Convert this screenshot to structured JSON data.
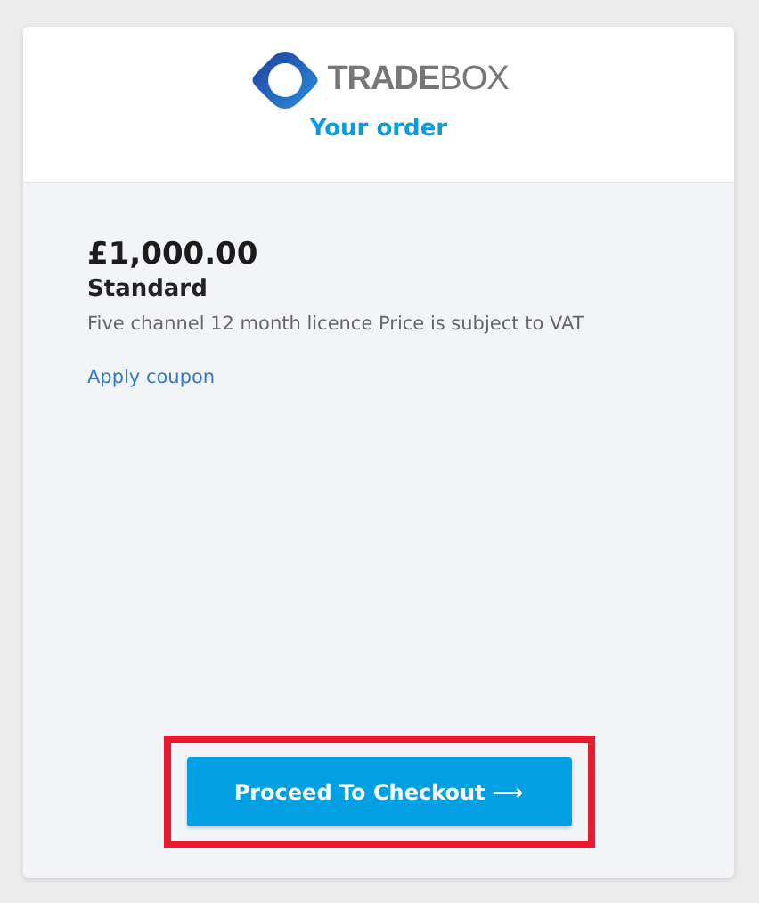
{
  "logo": {
    "text": "**TRADE**BOX"
  },
  "heading": "Your order",
  "order": {
    "price": "£1,000.00",
    "plan": "Standard",
    "description": "Five channel 12 month licence Price is subject to VAT",
    "coupon_link": "Apply coupon"
  },
  "checkout_button": {
    "label": "Proceed To Checkout ⟶",
    "highlighted": true
  }
}
